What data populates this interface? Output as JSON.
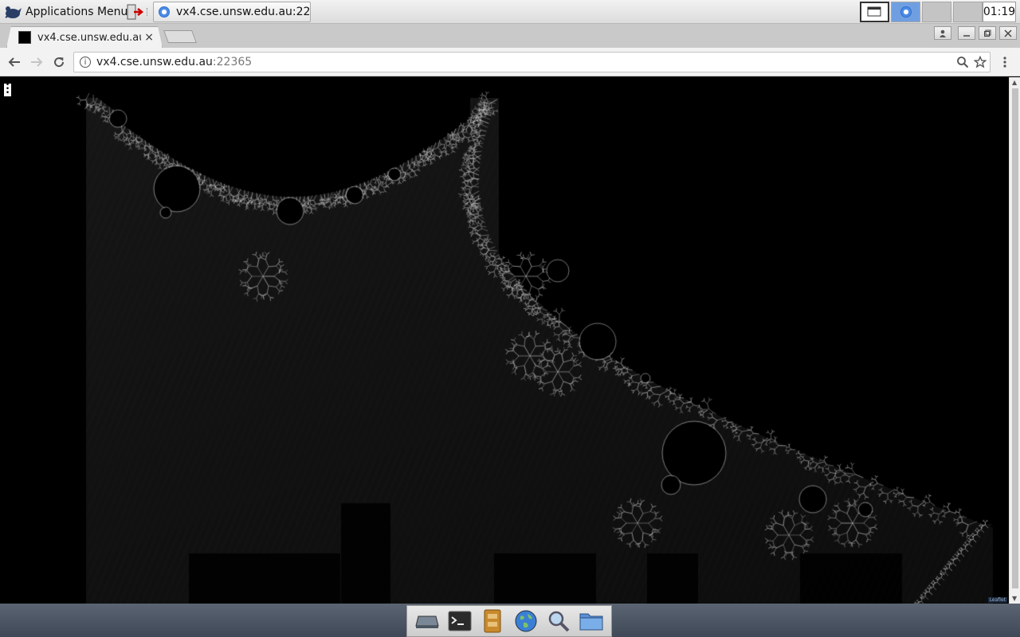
{
  "panel": {
    "apps_menu_label": "Applications Menu",
    "task_title": "vx4.cse.unsw.edu.au:22...",
    "clock": "01:19"
  },
  "browser": {
    "tab_title": "vx4.cse.unsw.edu.au",
    "tab_close": "×",
    "url_host": "vx4.cse.unsw.edu.au",
    "url_port": ":22365"
  },
  "content": {
    "attribution": "Leaflet"
  },
  "dock": {
    "items": [
      "show-desktop-icon",
      "terminal-icon",
      "file-manager-icon",
      "web-browser-icon",
      "search-icon",
      "folder-icon"
    ]
  }
}
